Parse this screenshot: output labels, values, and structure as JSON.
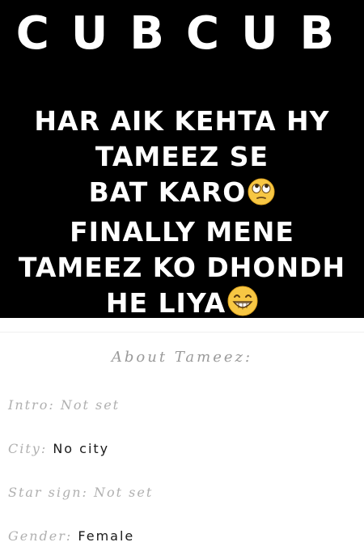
{
  "hero": {
    "title": "CUBCUB",
    "lines": [
      "HAR AIK KEHTA HY",
      "TAMEEZ SE",
      "BAT KARO",
      "FINALLY MENE",
      "TAMEEZ KO DHONDH",
      "HE LIYA"
    ],
    "emoji_line3": "eye-roll-emoji-icon",
    "emoji_line6": "grinning-emoji-icon"
  },
  "about": {
    "title": "About Tameez:",
    "rows": [
      {
        "label": "Intro:",
        "value": "Not set"
      },
      {
        "label": "City:",
        "value": "No city"
      },
      {
        "label": "Star sign:",
        "value": "Not set"
      },
      {
        "label": "Gender:",
        "value": "Female"
      }
    ]
  },
  "colors": {
    "hero_bg": "#000000",
    "hero_text": "#ffffff",
    "label": "#b0b0b0",
    "value_dark": "#1a1a1a"
  }
}
